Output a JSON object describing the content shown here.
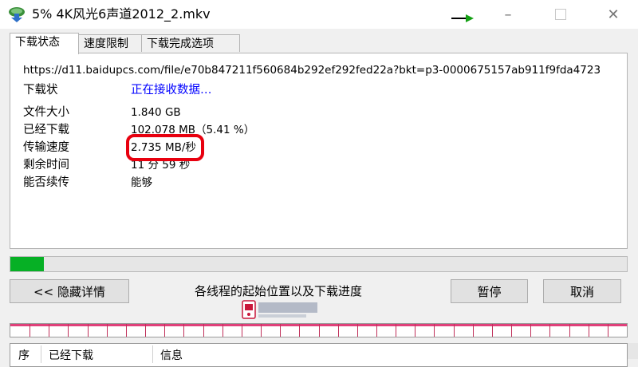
{
  "window": {
    "title": "5% 4K风光6声道2012_2.mkv",
    "controls": {
      "minimize": "–",
      "close": "✕"
    }
  },
  "tabs": [
    {
      "label": "下载状态",
      "active": true
    },
    {
      "label": "速度限制",
      "active": false
    },
    {
      "label": "下载完成选项",
      "active": false
    }
  ],
  "status": {
    "url": "https://d11.baidupcs.com/file/e70b847211f560684b292ef292fed22a?bkt=p3-0000675157ab911f9fda4723",
    "status_label": "下载状",
    "status_value": "正在接收数据…",
    "file_size_label": "文件大小",
    "file_size_value": "1.840  GB",
    "downloaded_label": "已经下载",
    "downloaded_value": "102.078  MB（5.41 %）",
    "speed_label": "传输速度",
    "speed_value": "2.735  MB/秒",
    "remaining_label": "剩余时间",
    "remaining_value": "11 分 59 秒",
    "resume_label": "能否续传",
    "resume_value": "能够"
  },
  "progress": {
    "percent": 5.41
  },
  "buttons": {
    "hide_details": "<< 隐藏详情",
    "threads_label": "各线程的起始位置以及下载进度",
    "pause": "暂停",
    "cancel": "取消"
  },
  "threads": {
    "segments": 32
  },
  "thread_list": {
    "columns": [
      "序",
      "已经下载",
      "信息"
    ]
  },
  "colors": {
    "progress_fill": "#06b025",
    "link": "#0000ff",
    "highlight": "#e8000f"
  }
}
